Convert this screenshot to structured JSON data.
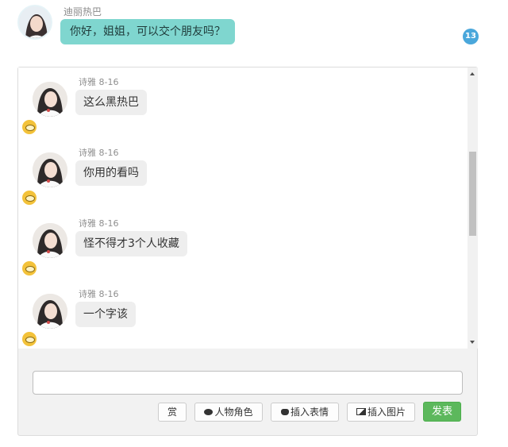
{
  "top_message": {
    "sender": "迪丽热巴",
    "text": "你好，姐姐，可以交个朋友吗？"
  },
  "unread_count": "13",
  "messages": [
    {
      "author": "诗雅",
      "date": "8-16",
      "text": "这么黑热巴"
    },
    {
      "author": "诗雅",
      "date": "8-16",
      "text": "你用的看吗"
    },
    {
      "author": "诗雅",
      "date": "8-16",
      "text": "怪不得才3个人收藏"
    },
    {
      "author": "诗雅",
      "date": "8-16",
      "text": "一个字该"
    }
  ],
  "composer": {
    "value": "",
    "buttons": {
      "reward": "赏",
      "role": "人物角色",
      "emoji": "插入表情",
      "image": "插入图片",
      "send": "发表"
    }
  },
  "colors": {
    "top_bubble": "#7fd6cf",
    "badge": "#4aa7db",
    "send": "#5cb85c",
    "eye_badge": "#f3c23a"
  },
  "icons": {
    "role": "chat-bubbles-icon",
    "emoji": "cat-face-icon",
    "image": "picture-icon",
    "level": "eye-icon"
  }
}
